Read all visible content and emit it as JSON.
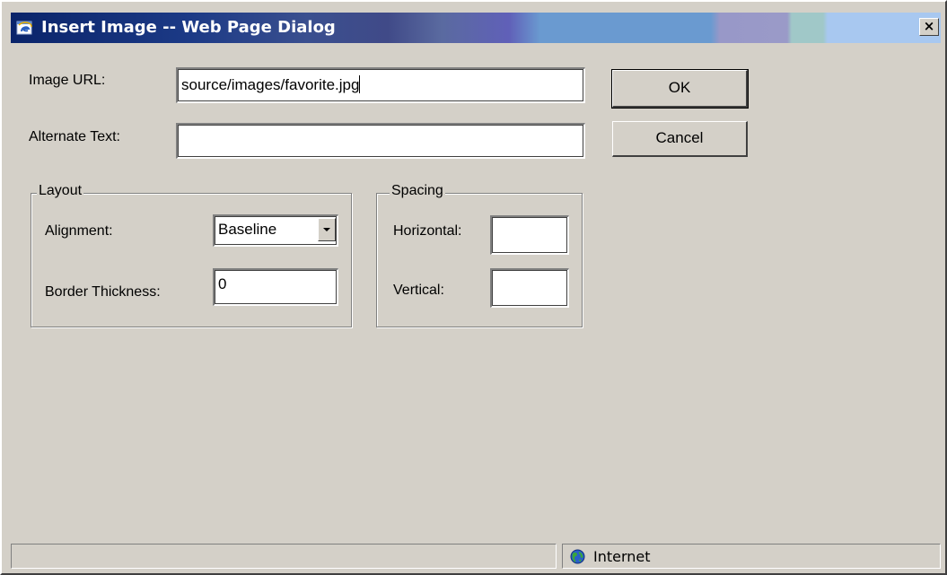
{
  "window": {
    "title": "Insert Image -- Web Page Dialog",
    "close_label": "×",
    "icons": {
      "app": "ie-dialog-icon",
      "close": "close-icon"
    }
  },
  "form": {
    "image_url": {
      "label": "Image URL:",
      "value": "source/images/favorite.jpg"
    },
    "alternate_text": {
      "label": "Alternate Text:",
      "value": ""
    }
  },
  "buttons": {
    "ok": "OK",
    "cancel": "Cancel"
  },
  "layout": {
    "legend": "Layout",
    "alignment": {
      "label": "Alignment:",
      "selected": "Baseline"
    },
    "border_thickness": {
      "label": "Border Thickness:",
      "value": "0"
    }
  },
  "spacing": {
    "legend": "Spacing",
    "horizontal": {
      "label": "Horizontal:",
      "value": ""
    },
    "vertical": {
      "label": "Vertical:",
      "value": ""
    }
  },
  "status": {
    "message": "",
    "zone": "Internet",
    "zone_icon": "globe-icon"
  },
  "colors": {
    "dialog_face": "#d4d0c8",
    "title_start": "#0a246a",
    "title_end": "#a8c8f0"
  }
}
